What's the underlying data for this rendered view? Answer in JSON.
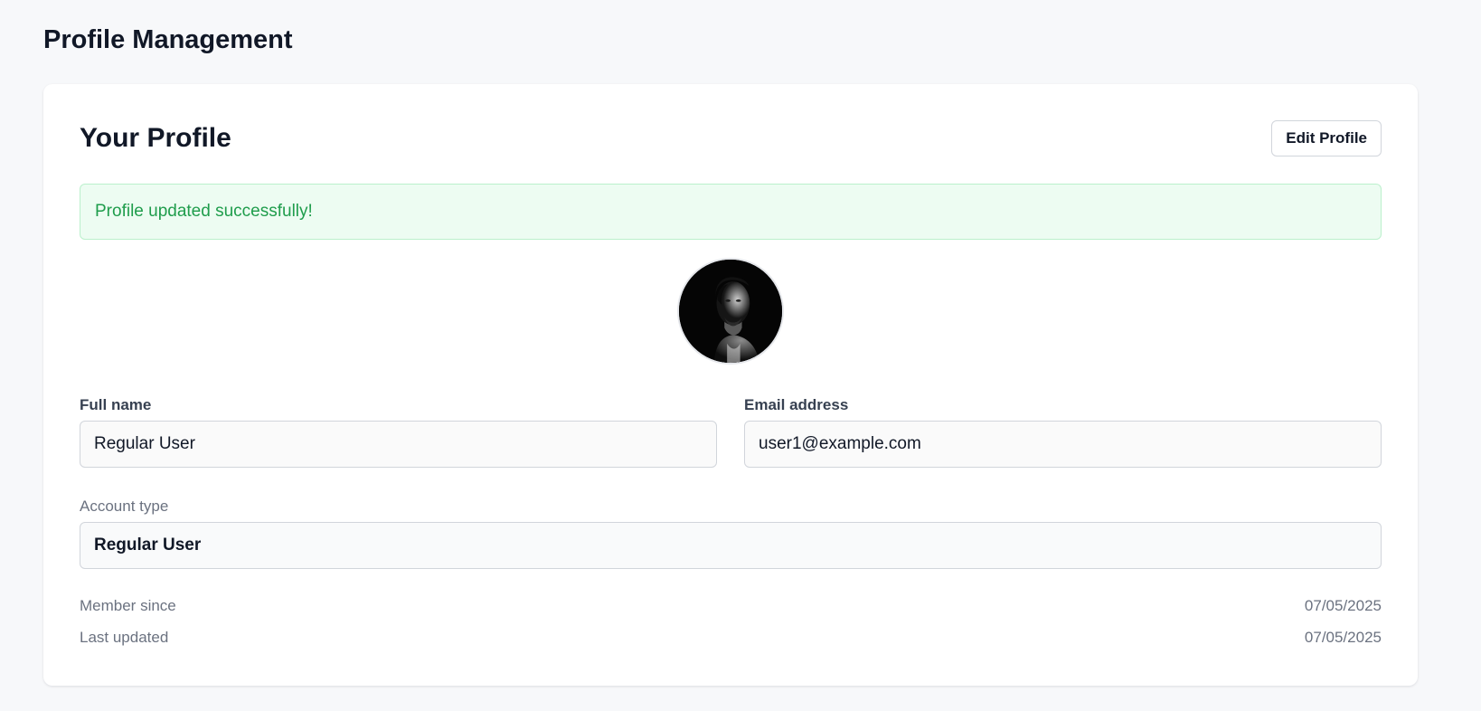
{
  "page": {
    "title": "Profile Management"
  },
  "profile": {
    "title": "Your Profile",
    "edit_button_label": "Edit Profile",
    "alert_message": "Profile updated successfully!",
    "avatar_icon": "user-photo",
    "full_name": {
      "label": "Full name",
      "value": "Regular User"
    },
    "email": {
      "label": "Email address",
      "value": "user1@example.com"
    },
    "account_type": {
      "label": "Account type",
      "value": "Regular User"
    },
    "member_since": {
      "label": "Member since",
      "value": "07/05/2025"
    },
    "last_updated": {
      "label": "Last updated",
      "value": "07/05/2025"
    }
  },
  "colors": {
    "page_background": "#f7f8fa",
    "card_background": "#ffffff",
    "success_background": "#edfcf2",
    "success_text": "#1f9d4c",
    "text_primary": "#111827",
    "text_muted": "#6b7280"
  }
}
